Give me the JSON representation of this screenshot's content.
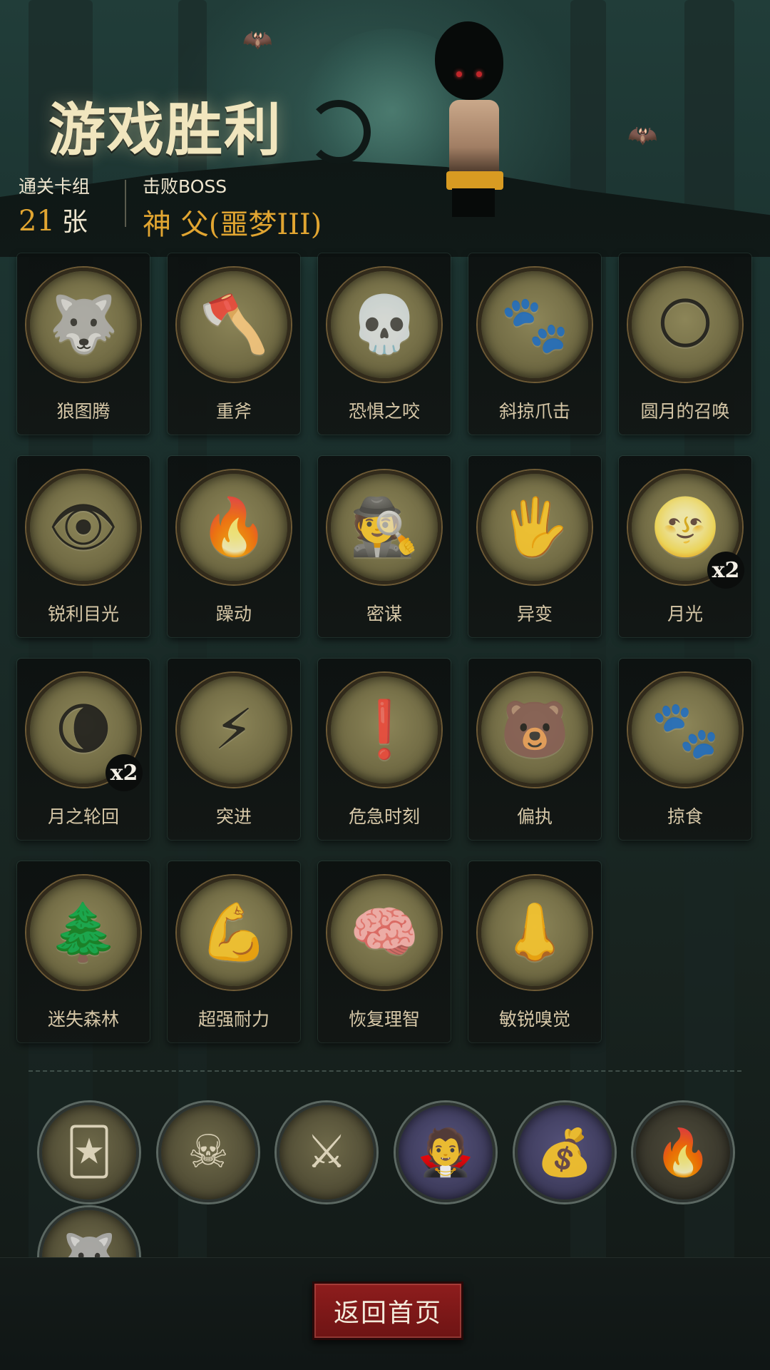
{
  "title": "游戏胜利",
  "stats": {
    "deck_label": "通关卡组",
    "deck_count": "21",
    "deck_unit": "张",
    "boss_label": "击败BOSS",
    "boss_name": "神 父(噩梦III)"
  },
  "cards": [
    {
      "name": "狼图腾",
      "icon": "wolf-totem-icon",
      "glyph": "🐺"
    },
    {
      "name": "重斧",
      "icon": "axe-icon",
      "glyph": "🪓"
    },
    {
      "name": "恐惧之咬",
      "icon": "skull-icon",
      "glyph": "💀"
    },
    {
      "name": "斜掠爪击",
      "icon": "claw-icon",
      "glyph": "🐾"
    },
    {
      "name": "圆月的召唤",
      "icon": "full-moon-icon",
      "glyph": "🌕"
    },
    {
      "name": "锐利目光",
      "icon": "werewolf-eyes-icon",
      "glyph": "👁"
    },
    {
      "name": "躁动",
      "icon": "rage-icon",
      "glyph": "🔥"
    },
    {
      "name": "密谋",
      "icon": "hooded-figures-icon",
      "glyph": "🕵"
    },
    {
      "name": "异变",
      "icon": "transformation-icon",
      "glyph": "🖐"
    },
    {
      "name": "月光",
      "icon": "moonlight-icon",
      "glyph": "🌝",
      "badge": "x2"
    },
    {
      "name": "月之轮回",
      "icon": "moon-phases-icon",
      "glyph": "🌘",
      "badge": "x2"
    },
    {
      "name": "突进",
      "icon": "lunge-icon",
      "glyph": "⚡"
    },
    {
      "name": "危急时刻",
      "icon": "critical-moment-icon",
      "glyph": "❗"
    },
    {
      "name": "偏执",
      "icon": "paranoia-icon",
      "glyph": "🐻"
    },
    {
      "name": "掠食",
      "icon": "predator-icon",
      "glyph": "🐾"
    },
    {
      "name": "迷失森林",
      "icon": "lost-forest-icon",
      "glyph": "🌲"
    },
    {
      "name": "超强耐力",
      "icon": "endurance-icon",
      "glyph": "💪"
    },
    {
      "name": "恢复理智",
      "icon": "sanity-icon",
      "glyph": "🧠"
    },
    {
      "name": "敏锐嗅觉",
      "icon": "keen-smell-icon",
      "glyph": "👃"
    }
  ],
  "relics": [
    {
      "icon": "hand-cards-icon",
      "glyph": "🃏",
      "style": "normal"
    },
    {
      "icon": "pirate-card-icon",
      "glyph": "☠",
      "style": "normal"
    },
    {
      "icon": "blades-icon",
      "glyph": "⚔",
      "style": "normal"
    },
    {
      "icon": "vampire-icon",
      "glyph": "🧛",
      "style": "alt"
    },
    {
      "icon": "gold-coins-icon",
      "glyph": "💰",
      "style": "alt"
    },
    {
      "icon": "fire-altar-icon",
      "glyph": "🔥",
      "style": "dark"
    },
    {
      "icon": "werewolf-relic-icon",
      "glyph": "🐺",
      "style": "normal"
    }
  ],
  "footer": {
    "home_button": "返回首页"
  }
}
